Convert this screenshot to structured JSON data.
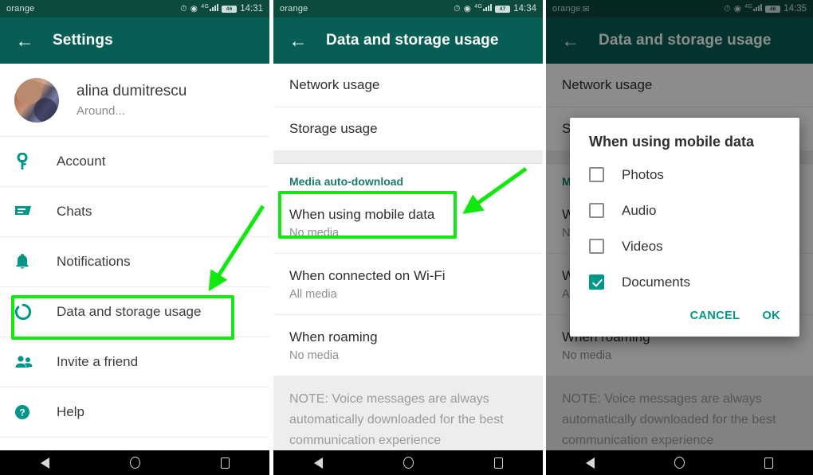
{
  "panels": [
    {
      "id": "settings",
      "status": {
        "carrier": "orange",
        "network": "4G",
        "battery": "46",
        "clock": "14:31",
        "mail_icon": ""
      },
      "appbar": {
        "title": "Settings",
        "back_icon": "back-arrow-icon"
      },
      "profile": {
        "name": "alina dumitrescu",
        "status": "Around..."
      },
      "items": [
        {
          "label": "Account",
          "icon": "key-icon"
        },
        {
          "label": "Chats",
          "icon": "chat-bubble-icon"
        },
        {
          "label": "Notifications",
          "icon": "bell-icon"
        },
        {
          "label": "Data and storage usage",
          "icon": "data-usage-icon",
          "highlighted": true
        },
        {
          "label": "Invite a friend",
          "icon": "people-icon"
        },
        {
          "label": "Help",
          "icon": "help-circle-icon"
        }
      ]
    },
    {
      "id": "data-and-storage",
      "status": {
        "carrier": "orange",
        "network": "4G",
        "battery": "47",
        "clock": "14:34",
        "mail_icon": ""
      },
      "appbar": {
        "title": "Data and storage usage",
        "back_icon": "back-arrow-icon"
      },
      "top_items": [
        {
          "title": "Network usage"
        },
        {
          "title": "Storage usage"
        }
      ],
      "section_title": "Media auto-download",
      "media_items": [
        {
          "title": "When using mobile data",
          "subtitle": "No media",
          "highlighted": true
        },
        {
          "title": "When connected on Wi-Fi",
          "subtitle": "All media"
        },
        {
          "title": "When roaming",
          "subtitle": "No media"
        }
      ],
      "note": "NOTE: Voice messages are always automatically downloaded for the best communication experience"
    },
    {
      "id": "data-and-storage-dialog",
      "status": {
        "carrier": "orange",
        "network": "4G",
        "battery": "46",
        "clock": "14:35",
        "mail_icon": "✉"
      },
      "appbar": {
        "title": "Data and storage usage",
        "back_icon": "back-arrow-icon"
      },
      "top_items": [
        {
          "title": "Network usage"
        },
        {
          "title": "Storage usage"
        }
      ],
      "section_title": "Media auto-download",
      "media_items": [
        {
          "title": "When using mobile data",
          "subtitle": "No media"
        },
        {
          "title": "When connected on Wi-Fi",
          "subtitle": "All media"
        },
        {
          "title": "When roaming",
          "subtitle": "No media"
        }
      ],
      "note": "NOTE: Voice messages are always automatically downloaded for the best communication experience",
      "dialog": {
        "title": "When using mobile data",
        "options": [
          {
            "label": "Photos",
            "checked": false
          },
          {
            "label": "Audio",
            "checked": false
          },
          {
            "label": "Videos",
            "checked": false
          },
          {
            "label": "Documents",
            "checked": true
          }
        ],
        "cancel_label": "CANCEL",
        "ok_label": "OK"
      }
    }
  ],
  "navbar": {
    "back": "nav-back-icon",
    "home": "nav-home-icon",
    "recents": "nav-recents-icon"
  },
  "annotations": {
    "highlight_color": "#10e810",
    "boxes": [
      {
        "target": "Data and storage usage"
      },
      {
        "target": "When using mobile data"
      }
    ],
    "arrows": [
      {
        "from": "upper-right",
        "to": "Data and storage usage"
      },
      {
        "from": "upper-right",
        "to": "When using mobile data"
      }
    ]
  },
  "colors": {
    "appbar_green": "#075e54",
    "statusbar_green": "#0d4a3e",
    "accent_teal": "#009688",
    "annotation_green": "#10e810"
  }
}
